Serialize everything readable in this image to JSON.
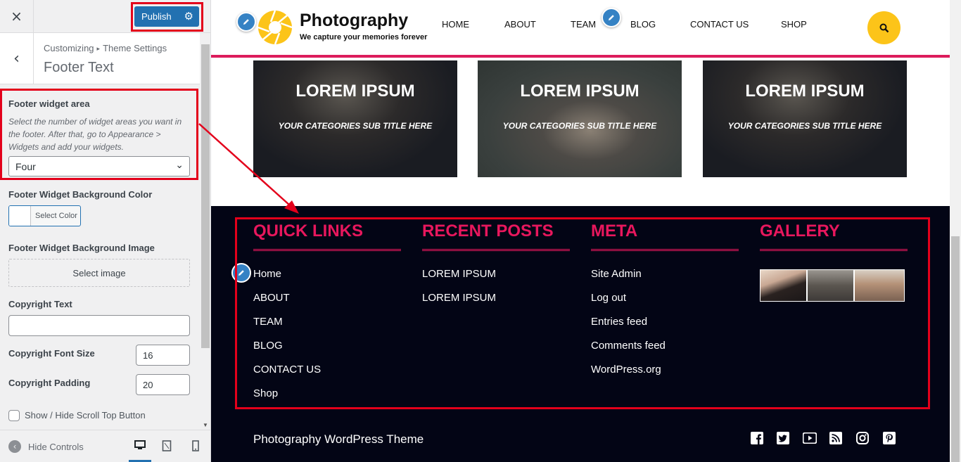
{
  "sidebar": {
    "close_label": "×",
    "publish_label": "Publish",
    "breadcrumb_root": "Customizing",
    "breadcrumb_sep": "▸",
    "breadcrumb_parent": "Theme Settings",
    "section_title": "Footer Text",
    "footer_widget_area": {
      "label": "Footer widget area",
      "description": "Select the number of widget areas you want in the footer. After that, go to Appearance > Widgets and add your widgets.",
      "selected": "Four"
    },
    "bg_color": {
      "label": "Footer Widget Background Color",
      "button": "Select Color"
    },
    "bg_image": {
      "label": "Footer Widget Background Image",
      "button": "Select image"
    },
    "copyright_text": {
      "label": "Copyright Text",
      "value": ""
    },
    "copyright_font_size": {
      "label": "Copyright Font Size",
      "value": "16"
    },
    "copyright_padding": {
      "label": "Copyright Padding",
      "value": "20"
    },
    "scroll_top": {
      "label": "Show / Hide Scroll Top Button"
    },
    "hide_controls": "Hide Controls"
  },
  "site": {
    "name": "Photography",
    "tagline": "We capture your memories forever",
    "nav": [
      "HOME",
      "ABOUT",
      "TEAM",
      "BLOG",
      "CONTACT US",
      "SHOP"
    ],
    "cards": [
      {
        "title": "LOREM IPSUM",
        "subtitle": "YOUR CATEGORIES SUB TITLE HERE"
      },
      {
        "title": "LOREM IPSUM",
        "subtitle": "YOUR CATEGORIES SUB TITLE HERE"
      },
      {
        "title": "LOREM IPSUM",
        "subtitle": "YOUR CATEGORIES SUB TITLE HERE"
      }
    ],
    "footer": {
      "quick_links": {
        "title": "QUICK LINKS",
        "items": [
          "Home",
          "ABOUT",
          "TEAM",
          "BLOG",
          "CONTACT US",
          "Shop"
        ]
      },
      "recent_posts": {
        "title": "RECENT POSTS",
        "items": [
          "LOREM IPSUM",
          "LOREM IPSUM"
        ]
      },
      "meta": {
        "title": "META",
        "items": [
          "Site Admin",
          "Log out",
          "Entries feed",
          "Comments feed",
          "WordPress.org"
        ]
      },
      "gallery": {
        "title": "GALLERY"
      },
      "copyright": "Photography WordPress Theme",
      "social_icons": [
        "facebook-icon",
        "twitter-icon",
        "youtube-icon",
        "rss-icon",
        "instagram-icon",
        "pinterest-icon"
      ]
    }
  },
  "colors": {
    "accent": "#e8175d",
    "publish": "#2271b1",
    "search": "#fcc419",
    "footer_bg": "#030515",
    "highlight": "#e3001b"
  }
}
